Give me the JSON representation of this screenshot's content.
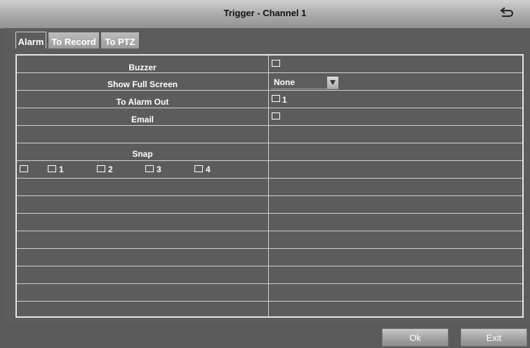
{
  "window": {
    "title": "Trigger - Channel 1"
  },
  "tabs": [
    {
      "label": "Alarm",
      "active": true
    },
    {
      "label": "To Record",
      "active": false
    },
    {
      "label": "To PTZ",
      "active": false
    }
  ],
  "rows": {
    "buzzer": {
      "label": "Buzzer",
      "checked": false
    },
    "show_full_screen": {
      "label": "Show Full Screen",
      "value": "None"
    },
    "alarm_out": {
      "label": "To Alarm Out",
      "option_label": "1",
      "checked": false
    },
    "email": {
      "label": "Email",
      "checked": false
    },
    "snap": {
      "label": "Snap",
      "options": [
        "",
        "1",
        "2",
        "3",
        "4"
      ]
    }
  },
  "buttons": {
    "ok": "Ok",
    "exit": "Exit"
  },
  "colors": {
    "title_bar": "#b8b8b8",
    "panel": "#5c5c5c",
    "grid_line": "#d0d0d0"
  }
}
